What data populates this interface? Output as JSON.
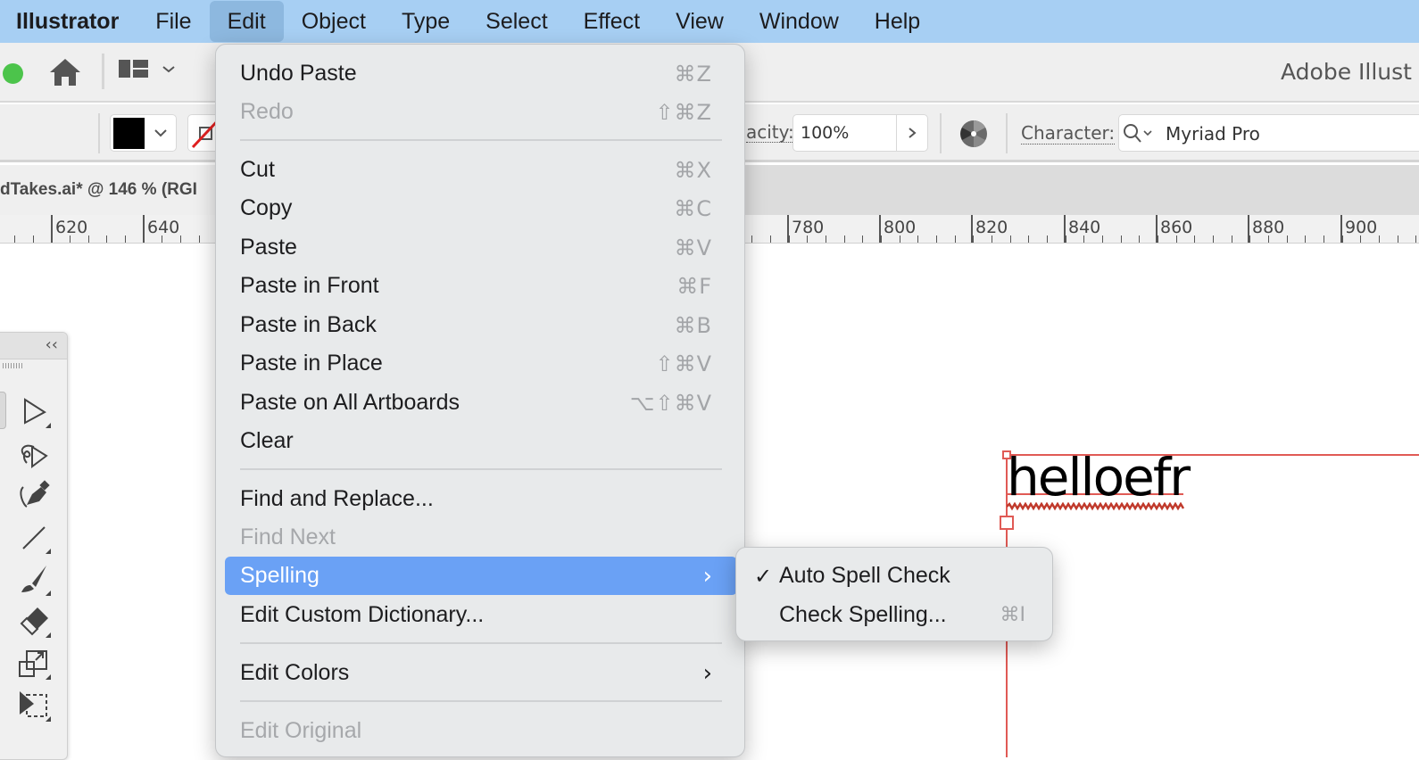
{
  "menubar": {
    "app_name": "Illustrator",
    "items": [
      "File",
      "Edit",
      "Object",
      "Type",
      "Select",
      "Effect",
      "View",
      "Window",
      "Help"
    ],
    "active_item": "Edit"
  },
  "appbar": {
    "workspace_title": "Adobe Illust",
    "home_icon": "home-icon",
    "layout_icon": "workspace-layout-icon"
  },
  "control_bar": {
    "fill_color": "#000000",
    "opacity_label": "acity:",
    "opacity_value": "100%",
    "character_label": "Character:",
    "font_search_icon": "search-icon",
    "font_name": "Myriad Pro"
  },
  "document": {
    "tab_title": "dTakes.ai* @ 146 % (RGI"
  },
  "ruler": {
    "labels": [
      "620",
      "640",
      "780",
      "800",
      "820",
      "840",
      "860",
      "880",
      "900"
    ]
  },
  "edit_menu": {
    "items": [
      {
        "label": "Undo Paste",
        "shortcut": "⌘Z",
        "disabled": false
      },
      {
        "label": "Redo",
        "shortcut": "⇧⌘Z",
        "disabled": true
      },
      {
        "label": "Cut",
        "shortcut": "⌘X",
        "disabled": false
      },
      {
        "label": "Copy",
        "shortcut": "⌘C",
        "disabled": false
      },
      {
        "label": "Paste",
        "shortcut": "⌘V",
        "disabled": false
      },
      {
        "label": "Paste in Front",
        "shortcut": "⌘F",
        "disabled": false
      },
      {
        "label": "Paste in Back",
        "shortcut": "⌘B",
        "disabled": false
      },
      {
        "label": "Paste in Place",
        "shortcut": "⇧⌘V",
        "disabled": false
      },
      {
        "label": "Paste on All Artboards",
        "shortcut": "⌥⇧⌘V",
        "disabled": false
      },
      {
        "label": "Clear",
        "shortcut": "",
        "disabled": false
      },
      {
        "label": "Find and Replace...",
        "shortcut": "",
        "disabled": false
      },
      {
        "label": "Find Next",
        "shortcut": "",
        "disabled": true
      },
      {
        "label": "Spelling",
        "shortcut": "",
        "disabled": false,
        "submenu": true,
        "highlighted": true
      },
      {
        "label": "Edit Custom Dictionary...",
        "shortcut": "",
        "disabled": false
      },
      {
        "label": "Edit Colors",
        "shortcut": "",
        "disabled": false,
        "submenu": true
      },
      {
        "label": "Edit Original",
        "shortcut": "",
        "disabled": true
      }
    ],
    "submenu_chevron": "›"
  },
  "spelling_submenu": {
    "items": [
      {
        "label": "Auto Spell Check",
        "checked": true,
        "check_glyph": "✓",
        "shortcut": ""
      },
      {
        "label": "Check Spelling...",
        "checked": false,
        "shortcut": "⌘I"
      }
    ]
  },
  "canvas": {
    "text_object": "helloefr",
    "selection_color": "#e05a55",
    "spell_error_color": "#c0392b"
  },
  "tools": [
    "direct-selection-tool",
    "lasso-select-tool",
    "pen-tool",
    "line-tool",
    "paintbrush-tool",
    "eraser-tool",
    "scale-tool",
    "artboard-tool"
  ],
  "colors": {
    "menubar_bg": "#a7cff3",
    "menu_highlight": "#6aa1f5",
    "window_green": "#4cc44b"
  }
}
